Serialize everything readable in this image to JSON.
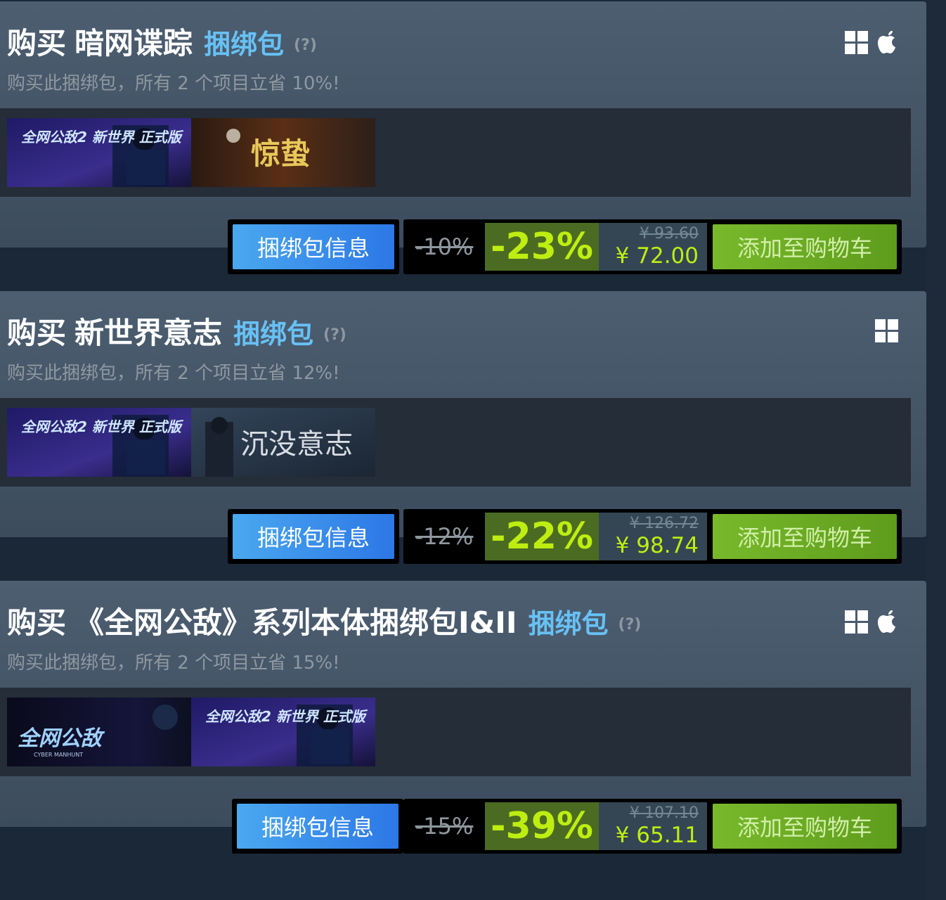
{
  "bundles": [
    {
      "buy_prefix": "购买",
      "name": "暗网谍踪",
      "kind_label": "捆绑包",
      "help": "(?)",
      "subtitle": "购买此捆绑包，所有 2 个项目立省 10%!",
      "platforms": [
        "windows-icon",
        "apple-icon"
      ],
      "capsules": [
        {
          "text": "全网公敌2 新世界 正式版"
        },
        {
          "text": "惊蛰"
        }
      ],
      "info_label": "捆绑包信息",
      "bundle_discount": "-10%",
      "discount_pct": "-23%",
      "original_price": "¥ 93.60",
      "final_price": "¥ 72.00",
      "cart_label": "添加至购物车"
    },
    {
      "buy_prefix": "购买",
      "name": "新世界意志",
      "kind_label": "捆绑包",
      "help": "(?)",
      "subtitle": "购买此捆绑包，所有 2 个项目立省 12%!",
      "platforms": [
        "windows-icon"
      ],
      "capsules": [
        {
          "text": "全网公敌2 新世界 正式版"
        },
        {
          "text": "沉没意志"
        }
      ],
      "info_label": "捆绑包信息",
      "bundle_discount": "-12%",
      "discount_pct": "-22%",
      "original_price": "¥ 126.72",
      "final_price": "¥ 98.74",
      "cart_label": "添加至购物车"
    },
    {
      "buy_prefix": "购买",
      "name": "《全网公敌》系列本体捆绑包I&II",
      "kind_label": "捆绑包",
      "help": "(?)",
      "subtitle": "购买此捆绑包，所有 2 个项目立省 15%!",
      "platforms": [
        "windows-icon",
        "apple-icon"
      ],
      "capsules": [
        {
          "text": "全网公敌",
          "subtext": "CYBER MANHUNT"
        },
        {
          "text": "全网公敌2 新世界 正式版"
        }
      ],
      "info_label": "捆绑包信息",
      "bundle_discount": "-15%",
      "discount_pct": "-39%",
      "original_price": "¥ 107.10",
      "final_price": "¥ 65.11",
      "cart_label": "添加至购物车"
    }
  ]
}
